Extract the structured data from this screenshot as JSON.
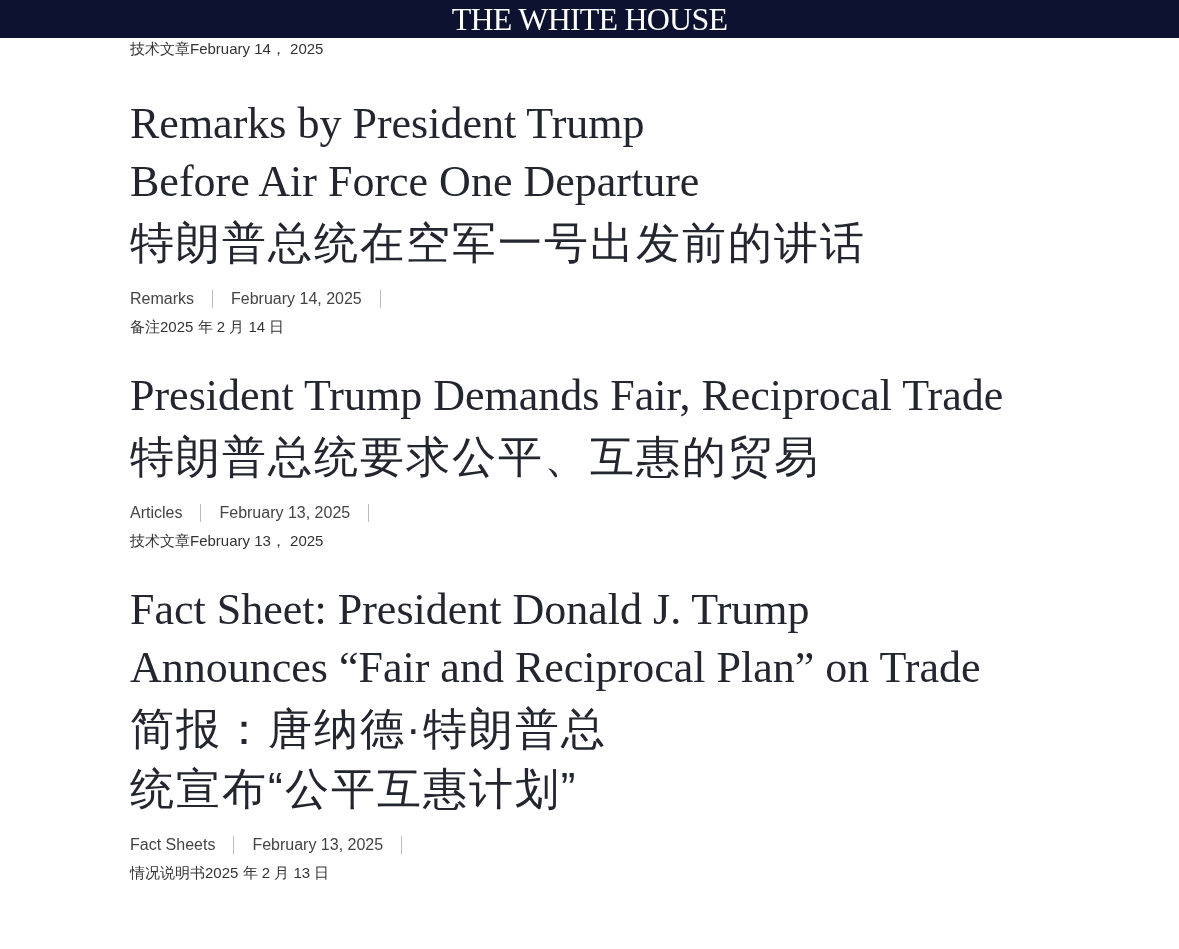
{
  "header": {
    "title": "THE WHITE HOUSE"
  },
  "top_meta_translation": "技术文章February 14， 2025",
  "articles": [
    {
      "title_lines": [
        "Remarks by President Trump",
        "Before Air Force One Departure"
      ],
      "title_translation_lines": [
        "特朗普总统在空军一号出发前的讲话"
      ],
      "category": "Remarks",
      "date": "February 14, 2025",
      "meta_translation": "备注2025 年 2 月 14 日"
    },
    {
      "title_lines": [
        "President Trump Demands Fair, Reciprocal Trade"
      ],
      "title_translation_lines": [
        "特朗普总统要求公平、互惠的贸易"
      ],
      "category": "Articles",
      "date": "February 13, 2025",
      "meta_translation": "技术文章February 13， 2025"
    },
    {
      "title_lines": [
        "Fact Sheet: President Donald J. Trump",
        "Announces “Fair and Reciprocal Plan” on Trade"
      ],
      "title_translation_lines": [
        "简报：唐纳德·特朗普总",
        "统宣布“公平互惠计划”"
      ],
      "category": "Fact Sheets",
      "date": "February 13, 2025",
      "meta_translation": "情况说明书2025 年 2 月 13 日"
    }
  ]
}
